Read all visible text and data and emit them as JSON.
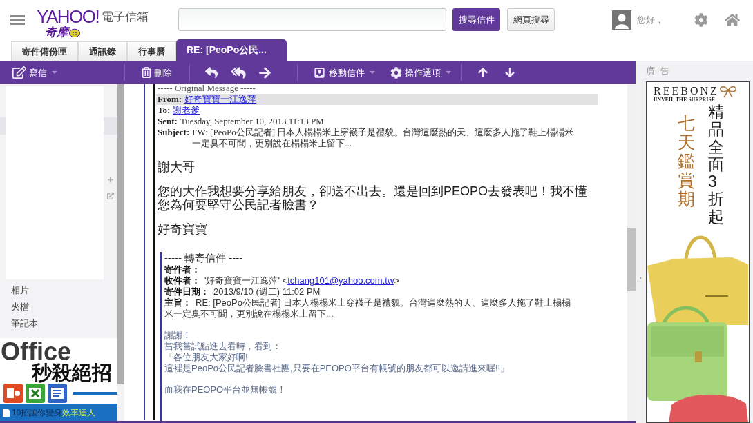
{
  "header": {
    "logo": {
      "wordmark": "YAHOO!",
      "subtitle": "奇摩"
    },
    "product": "電子信箱",
    "buttons": [
      {
        "label": "搜尋信件",
        "kind": "primary"
      },
      {
        "label": "網頁搜尋",
        "kind": "secondary"
      }
    ],
    "greeting": "您好，"
  },
  "tabs": [
    {
      "label": "寄件備份匣",
      "selected": false
    },
    {
      "label": "通訊錄",
      "selected": false
    },
    {
      "label": "行事曆",
      "selected": false
    },
    {
      "label": "RE: [PeoPo公民...",
      "selected": true
    }
  ],
  "toolbar": {
    "groups": [
      [
        {
          "kind": "compose",
          "label": "寫信",
          "dropdown": true
        }
      ],
      [
        {
          "kind": "delete",
          "label": "刪除",
          "dropdown": false
        }
      ],
      [
        {
          "kind": "reply"
        },
        {
          "kind": "reply_all"
        },
        {
          "kind": "forward"
        }
      ],
      [
        {
          "kind": "move",
          "label": "移動信件",
          "dropdown": true
        },
        {
          "kind": "actions",
          "label": "操作選項",
          "dropdown": true
        }
      ],
      [
        {
          "kind": "previous"
        },
        {
          "kind": "next"
        }
      ]
    ]
  },
  "sidebar": {
    "items": [
      {
        "label": "相片",
        "selected": false
      },
      {
        "label": "夾檔",
        "selected": false
      },
      {
        "label": "筆記本",
        "selected": false
      }
    ],
    "ad": {
      "title": "Office",
      "subtitle": "秒殺絕招",
      "tagline": "10招讓你變身",
      "highlight": "效率達人"
    }
  },
  "message": {
    "quote_header": "----- Original Message -----",
    "fields": [
      {
        "label": "From:",
        "value": "好奇寶寶一江逸萍",
        "kind": "link",
        "highlighted": true
      },
      {
        "label": "To:",
        "value": "謝老爹",
        "kind": "link",
        "highlighted": false
      },
      {
        "label": "Sent:",
        "value": "Tuesday, September 10, 2013 11:13 PM",
        "kind": "text",
        "highlighted": false
      },
      {
        "label": "Subject:",
        "value": "FW: [PeoPo公民記者] 日本人榻榻米上穿襪子是禮貌。台灣這麼熱的天、這麼多人拖了鞋上榻榻米一定臭不可聞，更別說在榻榻米上留下...",
        "kind": "text",
        "highlighted": false
      }
    ],
    "paragraphs": [
      "謝大哥",
      "您的大作我想要分享給朋友，卻送不出去。還是回到PEOPO去發表吧！我不懂您為何要堅守公民記者臉書？",
      "好奇寶寶"
    ],
    "forwarded": {
      "header": "----- 轉寄信件 ----",
      "fields": [
        {
          "label": "寄件者："
        },
        {
          "label": "收件者：",
          "value": "'好奇寶寶一江逸萍' <",
          "link": "tchang101@yahoo.com.tw",
          "suffix": ">"
        },
        {
          "label": "寄件日期：",
          "value": "2013/9/10 (週二) 11:02 PM"
        },
        {
          "label": "主旨：",
          "value": "RE: [PeoPo公民記者] 日本人榻榻米上穿襪子是禮貌。台灣這麼熱的天、這麼多人拖了鞋上榻榻米一定臭不可聞，更別說在榻榻米上留下..."
        }
      ],
      "paragraphs": [
        [
          "謝謝！",
          "當我嘗試點進去看時，看到：",
          "「各位朋友大家好啊!",
          "這裡是PeoPo公民記者臉書社團,只要在PEOPO平台有帳號的朋友都可以邀請進來喔!!」"
        ],
        [
          "而我在PEOPO平台並無帳號！"
        ]
      ]
    }
  },
  "ad_panel": {
    "label": "廣 告",
    "ad": {
      "brand": "REEBONZ",
      "tagline": "UNVEIL THE SURPRISE",
      "headline": "精品全面3折起",
      "subhead": "七天鑑賞期"
    }
  }
}
